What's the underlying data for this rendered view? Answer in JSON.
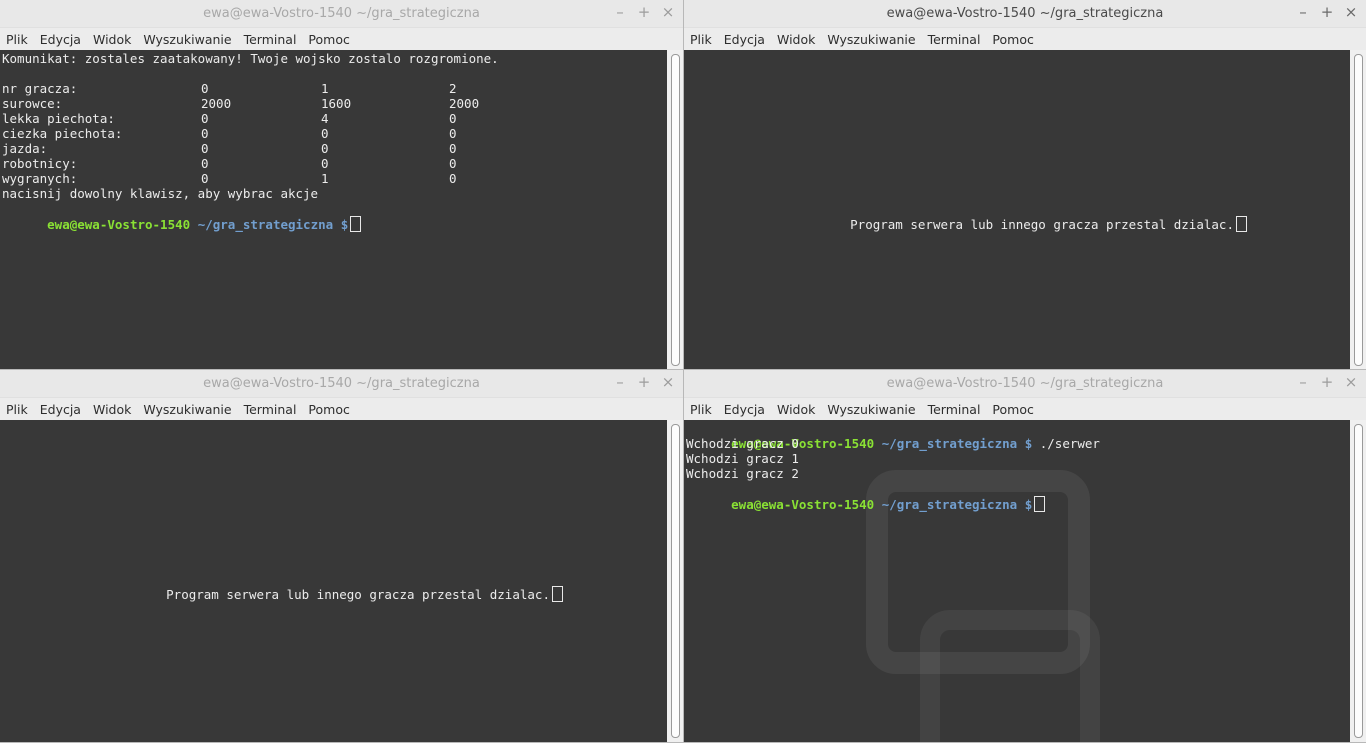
{
  "window_title": "ewa@ewa-Vostro-1540 ~/gra_strategiczna",
  "controls": {
    "minimize": "–",
    "maximize": "+",
    "close": "×"
  },
  "menu": [
    "Plik",
    "Edycja",
    "Widok",
    "Wyszukiwanie",
    "Terminal",
    "Pomoc"
  ],
  "prompt": {
    "user": "ewa@ewa-Vostro-1540",
    "path": "~/gra_strategiczna",
    "symbol": "$"
  },
  "top_left": {
    "message": "Komunikat: zostales zaatakowany! Twoje wojsko zostalo rozgromione.",
    "table": [
      {
        "label": "nr gracza:",
        "values": [
          "0",
          "1",
          "2"
        ]
      },
      {
        "label": "surowce:",
        "values": [
          "2000",
          "1600",
          "2000"
        ]
      },
      {
        "label": "lekka piechota:",
        "values": [
          "0",
          "4",
          "0"
        ]
      },
      {
        "label": "ciezka piechota:",
        "values": [
          "0",
          "0",
          "0"
        ]
      },
      {
        "label": "jazda:",
        "values": [
          "0",
          "0",
          "0"
        ]
      },
      {
        "label": "robotnicy:",
        "values": [
          "0",
          "0",
          "0"
        ]
      },
      {
        "label": "wygranych:",
        "values": [
          "0",
          "1",
          "0"
        ]
      }
    ],
    "hint": "nacisnij dowolny klawisz, aby wybrac akcje"
  },
  "top_right": {
    "message": "Program serwera lub innego gracza przestal dzialac."
  },
  "bottom_left": {
    "message": "Program serwera lub innego gracza przestal dzialac."
  },
  "bottom_right": {
    "command": "./serwer",
    "output": [
      "Wchodzi gracz 0",
      "Wchodzi gracz 1",
      "Wchodzi gracz 2"
    ]
  },
  "colors": {
    "prompt_user": "#8ae234",
    "prompt_path": "#729fcf",
    "terminal_bg": "#383838"
  }
}
